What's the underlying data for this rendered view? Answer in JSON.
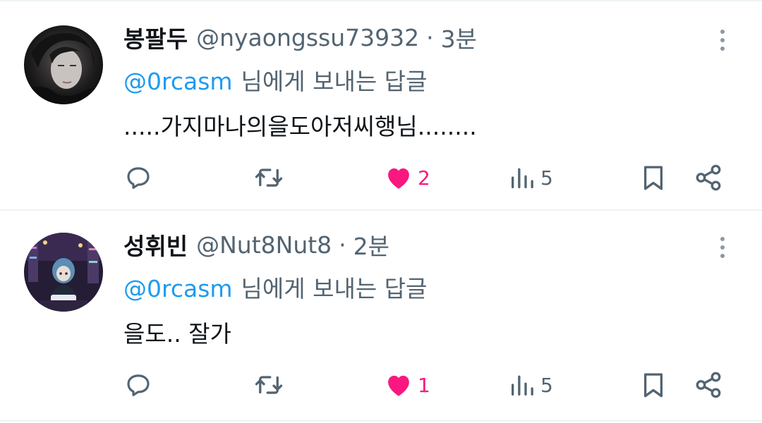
{
  "tweets": [
    {
      "name": "봉팔두",
      "handle": "@nyaongssu73932",
      "dot": "·",
      "time": "3분",
      "reply_mention": "@0rcasm",
      "reply_suffix": "님에게 보내는 답글",
      "text": ".....가지마나의을도아저씨행님........",
      "likes": "2",
      "views": "5"
    },
    {
      "name": "성휘빈",
      "handle": "@Nut8Nut8",
      "dot": "·",
      "time": "2분",
      "reply_mention": "@0rcasm",
      "reply_suffix": "님에게 보내는 답글",
      "text": "을도.. 잘가",
      "likes": "1",
      "views": "5"
    }
  ],
  "icons": {
    "reply": "reply-icon",
    "retweet": "retweet-icon",
    "like": "heart-icon",
    "views": "views-icon",
    "bookmark": "bookmark-icon",
    "share": "share-icon",
    "more": "more-icon"
  },
  "colors": {
    "text": "#0f1419",
    "secondary": "#536471",
    "mention": "#1d9bf0",
    "like": "#f91880",
    "divider": "#eff3f4"
  }
}
